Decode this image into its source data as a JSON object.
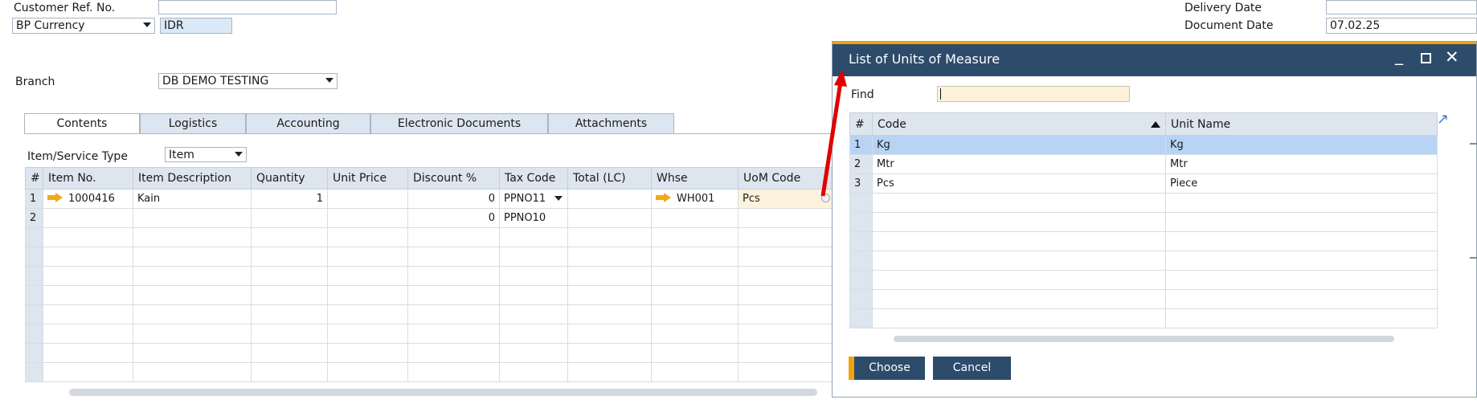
{
  "header": {
    "customer_ref_label": "Customer Ref. No.",
    "customer_ref_value": "",
    "bp_currency_label": "BP Currency",
    "bp_currency_value": "IDR",
    "branch_label": "Branch",
    "branch_value": "DB DEMO TESTING",
    "delivery_date_label": "Delivery Date",
    "delivery_date_value": "",
    "document_date_label": "Document Date",
    "document_date_value": "07.02.25"
  },
  "tabs": [
    {
      "label": "Contents",
      "active": true
    },
    {
      "label": "Logistics",
      "active": false
    },
    {
      "label": "Accounting",
      "active": false
    },
    {
      "label": "Electronic Documents",
      "active": false
    },
    {
      "label": "Attachments",
      "active": false
    }
  ],
  "item_type": {
    "label": "Item/Service Type",
    "value": "Item"
  },
  "grid": {
    "columns": [
      "#",
      "Item No.",
      "Item Description",
      "Quantity",
      "Unit Price",
      "Discount %",
      "Tax Code",
      "Total (LC)",
      "Whse",
      "UoM Code"
    ],
    "rows": [
      {
        "n": "1",
        "item_no": "1000416",
        "desc": "Kain",
        "qty": "1",
        "price": "",
        "disc": "0",
        "tax": "PPNO11",
        "total": "",
        "whse": "WH001",
        "uom": "Pcs"
      },
      {
        "n": "2",
        "item_no": "",
        "desc": "",
        "qty": "",
        "price": "",
        "disc": "0",
        "tax": "PPNO10",
        "total": "",
        "whse": "",
        "uom": ""
      }
    ]
  },
  "dialog": {
    "title": "List of Units of Measure",
    "find_label": "Find",
    "find_value": "",
    "columns": [
      "#",
      "Code",
      "Unit Name"
    ],
    "rows": [
      {
        "n": "1",
        "code": "Kg",
        "name": "Kg",
        "selected": true
      },
      {
        "n": "2",
        "code": "Mtr",
        "name": "Mtr",
        "selected": false
      },
      {
        "n": "3",
        "code": "Pcs",
        "name": "Piece",
        "selected": false
      }
    ],
    "choose_label": "Choose",
    "cancel_label": "Cancel"
  },
  "colors": {
    "title_bar": "#2d4b6b",
    "accent": "#f0a30a",
    "selected_row": "#b8d4f5",
    "annotation_arrow": "#e00000"
  }
}
